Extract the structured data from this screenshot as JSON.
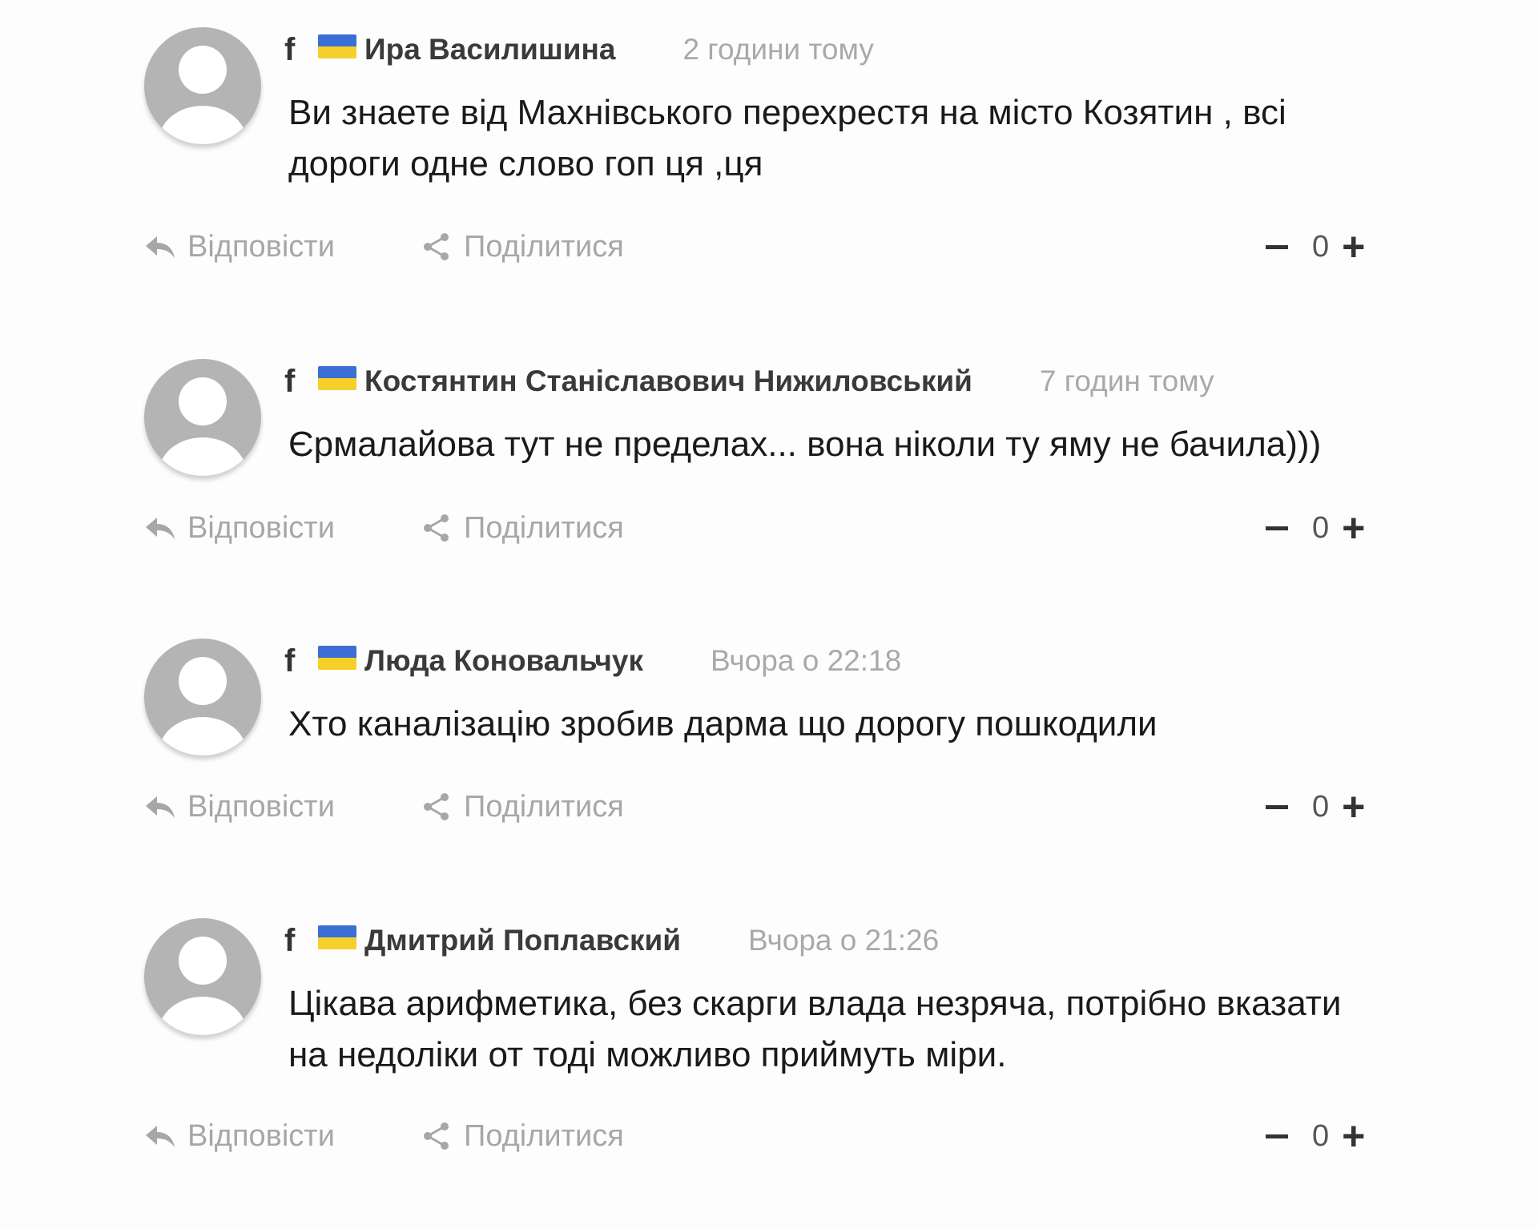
{
  "comments": [
    {
      "author": "Ира Василишина",
      "time": "2 години тому",
      "text": "Ви знаете від Махнівського перехрестя на місто Козятин , всі дороги одне слово гоп ця ,ця",
      "reply_label": "Відповісти",
      "share_label": "Поділитися",
      "score": "0"
    },
    {
      "author": "Костянтин Станіславович Нижиловський",
      "time": "7 годин тому",
      "text": "Єрмалайова тут не пределах... вона ніколи ту яму не бачила)))",
      "reply_label": "Відповісти",
      "share_label": "Поділитися",
      "score": "0"
    },
    {
      "author": "Люда Коновальчук",
      "time": "Вчора о 22:18",
      "text": "Хто каналізацію зробив дарма що дорогу пошкодили",
      "reply_label": "Відповісти",
      "share_label": "Поділитися",
      "score": "0"
    },
    {
      "author": "Дмитрий Поплавский",
      "time": "Вчора о 21:26",
      "text": "Цікава арифметика, без скарги влада незряча, потрібно вказати на недоліки от тоді можливо приймуть міри.",
      "reply_label": "Відповісти",
      "share_label": "Поділитися",
      "score": "0"
    }
  ],
  "icons": {
    "source": "facebook-icon",
    "flag": "ukraine-flag-icon",
    "reply": "reply-arrow-icon",
    "share": "share-icon",
    "downvote": "minus-icon",
    "upvote": "plus-icon"
  },
  "colors": {
    "flag_blue": "#3b6fd4",
    "flag_yellow": "#f6cf2a",
    "avatar": "#b4b4b4",
    "muted_text": "#a7a7a7"
  }
}
